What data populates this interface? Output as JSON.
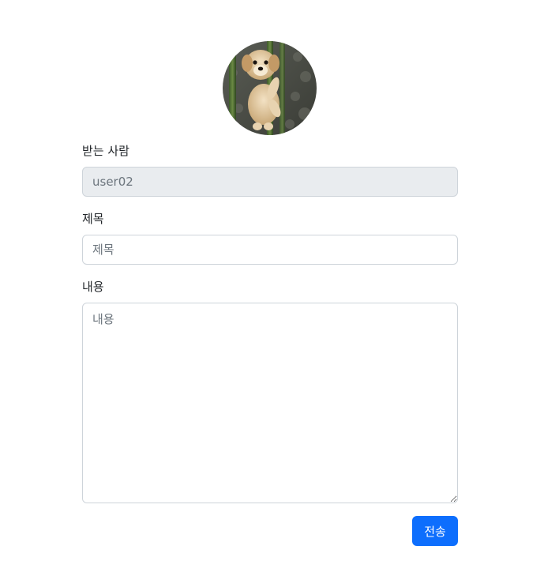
{
  "profile": {
    "avatar_icon": "dog-photo-avatar"
  },
  "form": {
    "recipient": {
      "label": "받는 사람",
      "value": "user02"
    },
    "title": {
      "label": "제목",
      "placeholder": "제목",
      "value": ""
    },
    "content": {
      "label": "내용",
      "placeholder": "내용",
      "value": ""
    },
    "submit_label": "전송"
  },
  "colors": {
    "primary": "#0d6efd",
    "disabled_bg": "#e9ecef",
    "border": "#ced4da"
  }
}
